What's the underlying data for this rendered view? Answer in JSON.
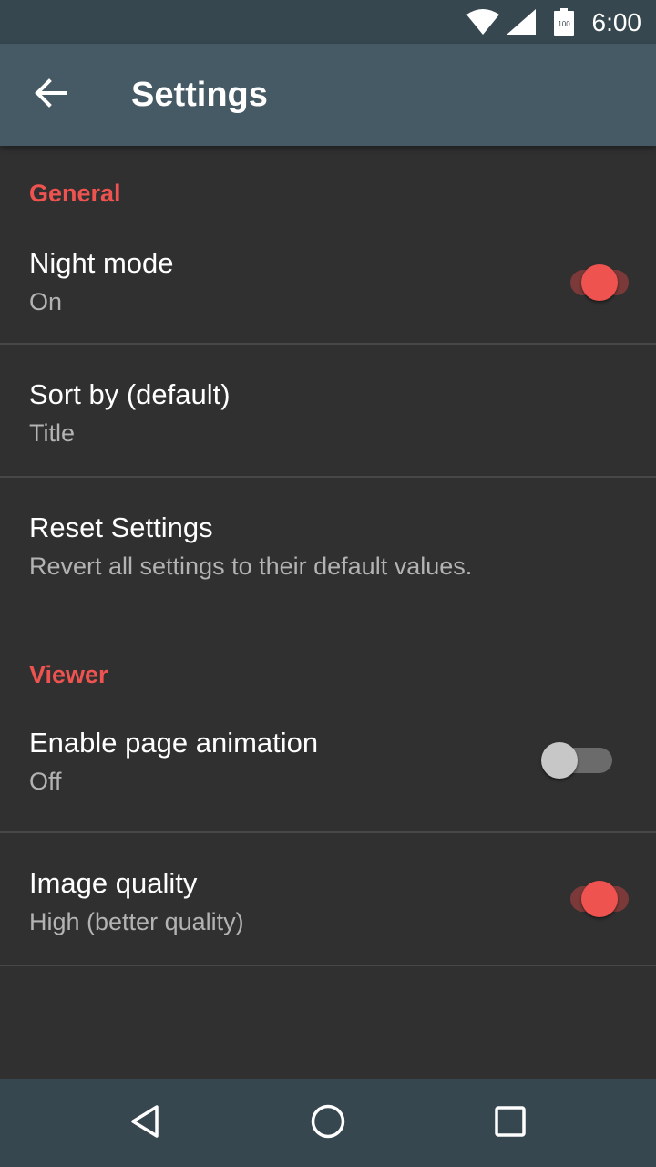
{
  "status_bar": {
    "time": "6:00",
    "battery_level": "100",
    "icons": [
      "wifi-icon",
      "cell-signal-icon",
      "battery-icon"
    ]
  },
  "app_bar": {
    "title": "Settings",
    "back_icon": "arrow-back-icon"
  },
  "sections": {
    "general": {
      "header": "General",
      "night_mode": {
        "title": "Night mode",
        "summary": "On",
        "enabled": true
      },
      "sort_by": {
        "title": "Sort by (default)",
        "summary": "Title"
      },
      "reset": {
        "title": "Reset Settings",
        "summary": "Revert all settings to their default values."
      }
    },
    "viewer": {
      "header": "Viewer",
      "page_animation": {
        "title": "Enable page animation",
        "summary": "Off",
        "enabled": false
      },
      "image_quality": {
        "title": "Image quality",
        "summary": "High (better quality)",
        "enabled": true
      }
    }
  },
  "nav_bar": {
    "icons": [
      "back-triangle-icon",
      "home-circle-icon",
      "recents-square-icon"
    ]
  },
  "colors": {
    "accent": "#ef5350",
    "app_bar": "#455a64",
    "status_bar": "#37474f",
    "background": "#303030"
  }
}
